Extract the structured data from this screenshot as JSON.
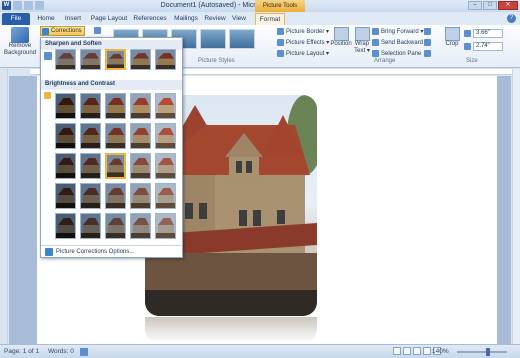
{
  "window": {
    "title": "Document1 (Autosaved) - Microsoft Word",
    "context_tab_group": "Picture Tools",
    "word_logo": "W",
    "controls": {
      "minimize": "–",
      "maximize": "□",
      "close": "✕"
    }
  },
  "tabs": {
    "file": "File",
    "home": "Home",
    "insert": "Insert",
    "page_layout": "Page Layout",
    "references": "References",
    "mailings": "Mailings",
    "review": "Review",
    "view": "View",
    "format": "Format",
    "help": "?"
  },
  "ribbon": {
    "remove_background": "Remove Background",
    "corrections": "Corrections ▾",
    "picture_styles_label": "Picture Styles",
    "picture_border": "Picture Border ▾",
    "picture_effects": "Picture Effects ▾",
    "picture_layout": "Picture Layout ▾",
    "position": "Position",
    "wrap_text": "Wrap Text ▾",
    "bring_forward": "Bring Forward ▾",
    "send_backward": "Send Backward ▾",
    "selection_pane": "Selection Pane",
    "arrange_label": "Arrange",
    "crop": "Crop",
    "height": "3.66\"",
    "width": "2.74\"",
    "size_label": "Size"
  },
  "dropdown": {
    "sharpen_soften": "Sharpen and Soften",
    "brightness_contrast": "Brightness and Contrast",
    "footer": "Picture Corrections Options..."
  },
  "status": {
    "page": "Page: 1 of 1",
    "words": "Words: 0",
    "zoom": "140%"
  },
  "colors": {
    "accent": "#2b579a",
    "context": "#e9ae3c",
    "ribbon": "#e6edf7"
  }
}
